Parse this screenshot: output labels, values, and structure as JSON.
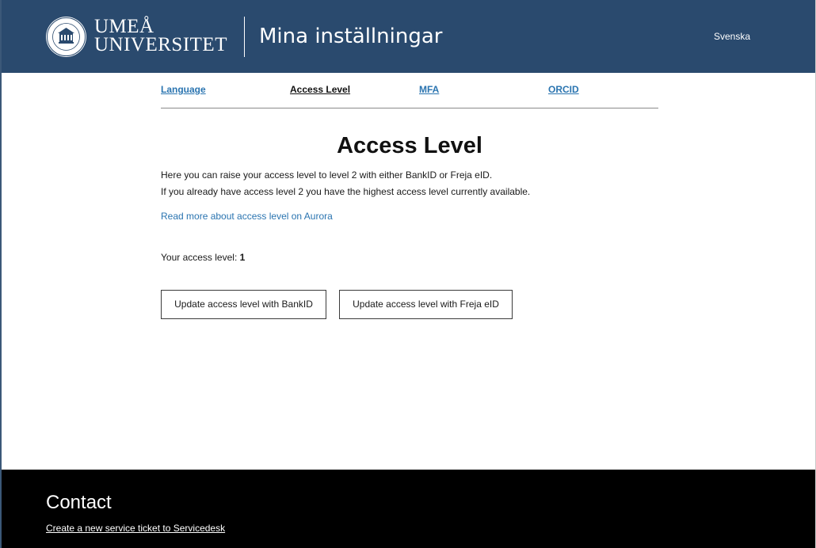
{
  "header": {
    "logo_line1": "UMEÅ",
    "logo_line2": "UNIVERSITET",
    "title": "Mina inställningar",
    "language_toggle": "Svenska"
  },
  "tabs": [
    {
      "label": "Language",
      "active": false
    },
    {
      "label": "Access Level",
      "active": true
    },
    {
      "label": "MFA",
      "active": false
    },
    {
      "label": "ORCID",
      "active": false
    }
  ],
  "main": {
    "title": "Access Level",
    "intro_line1": "Here you can raise your access level to level 2 with either BankID or Freja eID.",
    "intro_line2": "If you already have access level 2 you have the highest access level currently available.",
    "read_more_link": "Read more about access level on Aurora",
    "access_label": "Your access level:",
    "access_value": "1",
    "button_bankid": "Update access level with BankID",
    "button_freja": "Update access level with Freja eID"
  },
  "footer": {
    "title": "Contact",
    "link": "Create a new service ticket to Servicedesk"
  },
  "colors": {
    "header_bg": "#2a4a6e",
    "link": "#2a74b0",
    "footer_bg": "#000000"
  },
  "icons": {
    "logo": "university-seal-icon"
  }
}
